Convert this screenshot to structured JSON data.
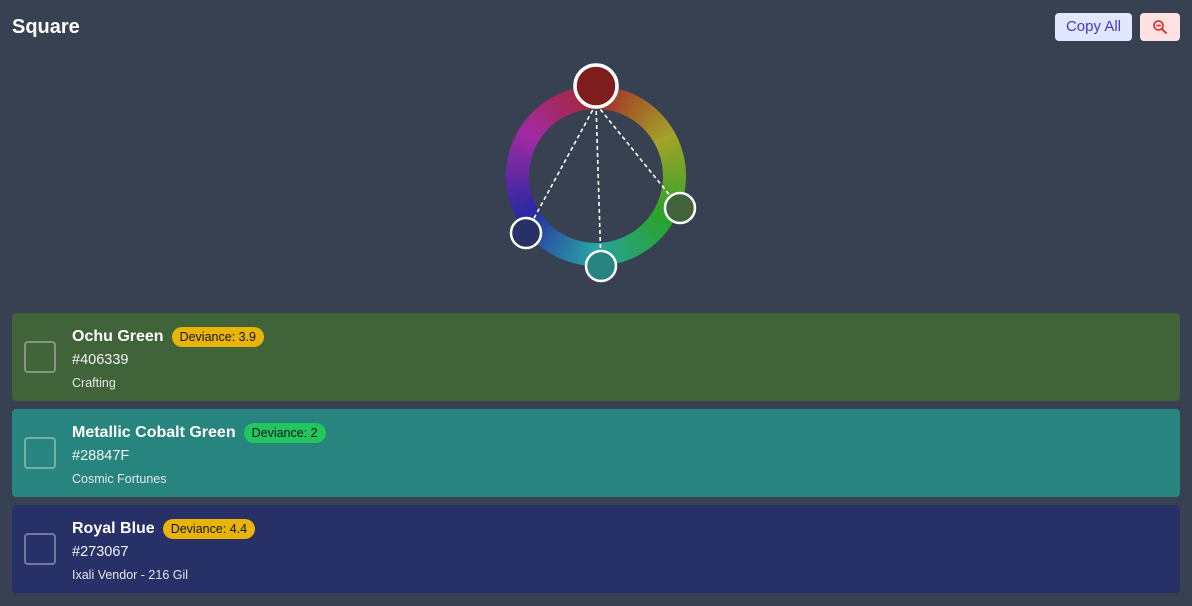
{
  "header": {
    "title": "Square",
    "copy_all_label": "Copy All",
    "zoom_out_icon": "zoom-out-icon"
  },
  "colors": {
    "background": "#374151",
    "base_dot": "#7f1d1d",
    "copy_button_bg": "#e0e7ff",
    "zoom_button_bg": "#fee2e2"
  },
  "wheel": {
    "points": [
      {
        "label": "base",
        "hue_color": "#7f1d1d"
      },
      {
        "label": "Ochu Green",
        "hue_color": "#406339"
      },
      {
        "label": "Metallic Cobalt Green",
        "hue_color": "#28847F"
      },
      {
        "label": "Royal Blue",
        "hue_color": "#273067"
      }
    ]
  },
  "colors_list": [
    {
      "name": "Ochu Green",
      "deviance": "Deviance: 3.9",
      "hex": "#406339",
      "source": "Crafting",
      "bg": "#406339",
      "badge_color": "#eab308"
    },
    {
      "name": "Metallic Cobalt Green",
      "deviance": "Deviance: 2",
      "hex": "#28847F",
      "source": "Cosmic Fortunes",
      "bg": "#28847F",
      "badge_color": "#22c55e"
    },
    {
      "name": "Royal Blue",
      "deviance": "Deviance: 4.4",
      "hex": "#273067",
      "source": "Ixali Vendor - 216 Gil",
      "bg": "#273067",
      "badge_color": "#eab308"
    }
  ]
}
